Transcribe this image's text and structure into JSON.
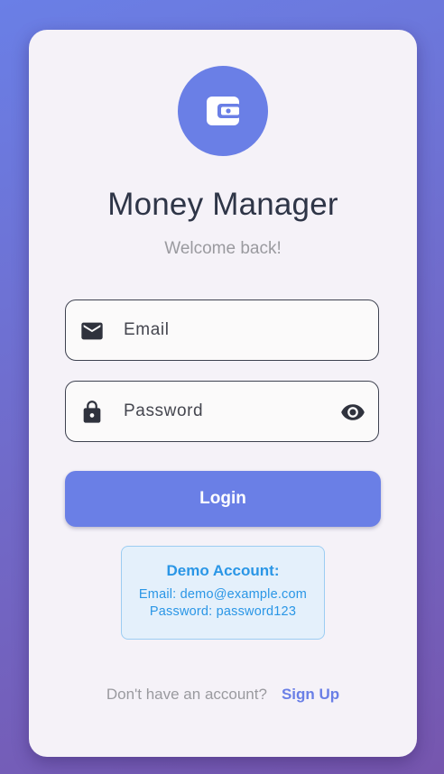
{
  "app": {
    "title": "Money Manager",
    "subtitle": "Welcome back!",
    "logo_icon": "wallet-icon"
  },
  "form": {
    "email": {
      "placeholder": "Email",
      "value": "",
      "icon": "mail-icon"
    },
    "password": {
      "placeholder": "Password",
      "value": "",
      "icon": "lock-icon",
      "toggle_icon": "eye-icon"
    },
    "login_label": "Login"
  },
  "demo": {
    "title": "Demo Account:",
    "email_line": "Email: demo@example.com",
    "password_line": "Password: password123"
  },
  "signup": {
    "prompt": "Don't have an account?",
    "link": "Sign Up"
  },
  "colors": {
    "primary": "#6a7fe6",
    "card_background": "#f5f2f8",
    "title_text": "#2e3547",
    "demo_accent": "#2a96e6",
    "gradient_start": "#6a7fe6",
    "gradient_end": "#7656ae"
  }
}
